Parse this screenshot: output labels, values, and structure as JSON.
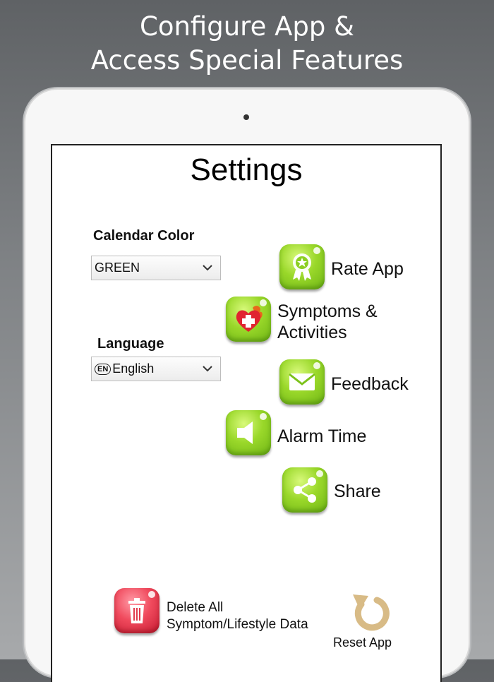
{
  "promo": {
    "line1": "Configure App &",
    "line2": "Access Special Features"
  },
  "settings": {
    "title": "Settings",
    "calendar_color": {
      "label": "Calendar Color",
      "value": "GREEN"
    },
    "language": {
      "label": "Language",
      "badge": "EN",
      "value": "English"
    }
  },
  "menu": {
    "rate_app": "Rate App",
    "symptoms_line1": "Symptoms &",
    "symptoms_line2": "Activities",
    "feedback": "Feedback",
    "alarm_time": "Alarm Time",
    "share": "Share"
  },
  "actions": {
    "delete_line1": "Delete All",
    "delete_line2": "Symptom/Lifestyle Data",
    "reset_app": "Reset App"
  },
  "colors": {
    "accent_green": "#9ad82a",
    "delete_red": "#f04a5d",
    "reset_tan": "#d8bb86"
  }
}
